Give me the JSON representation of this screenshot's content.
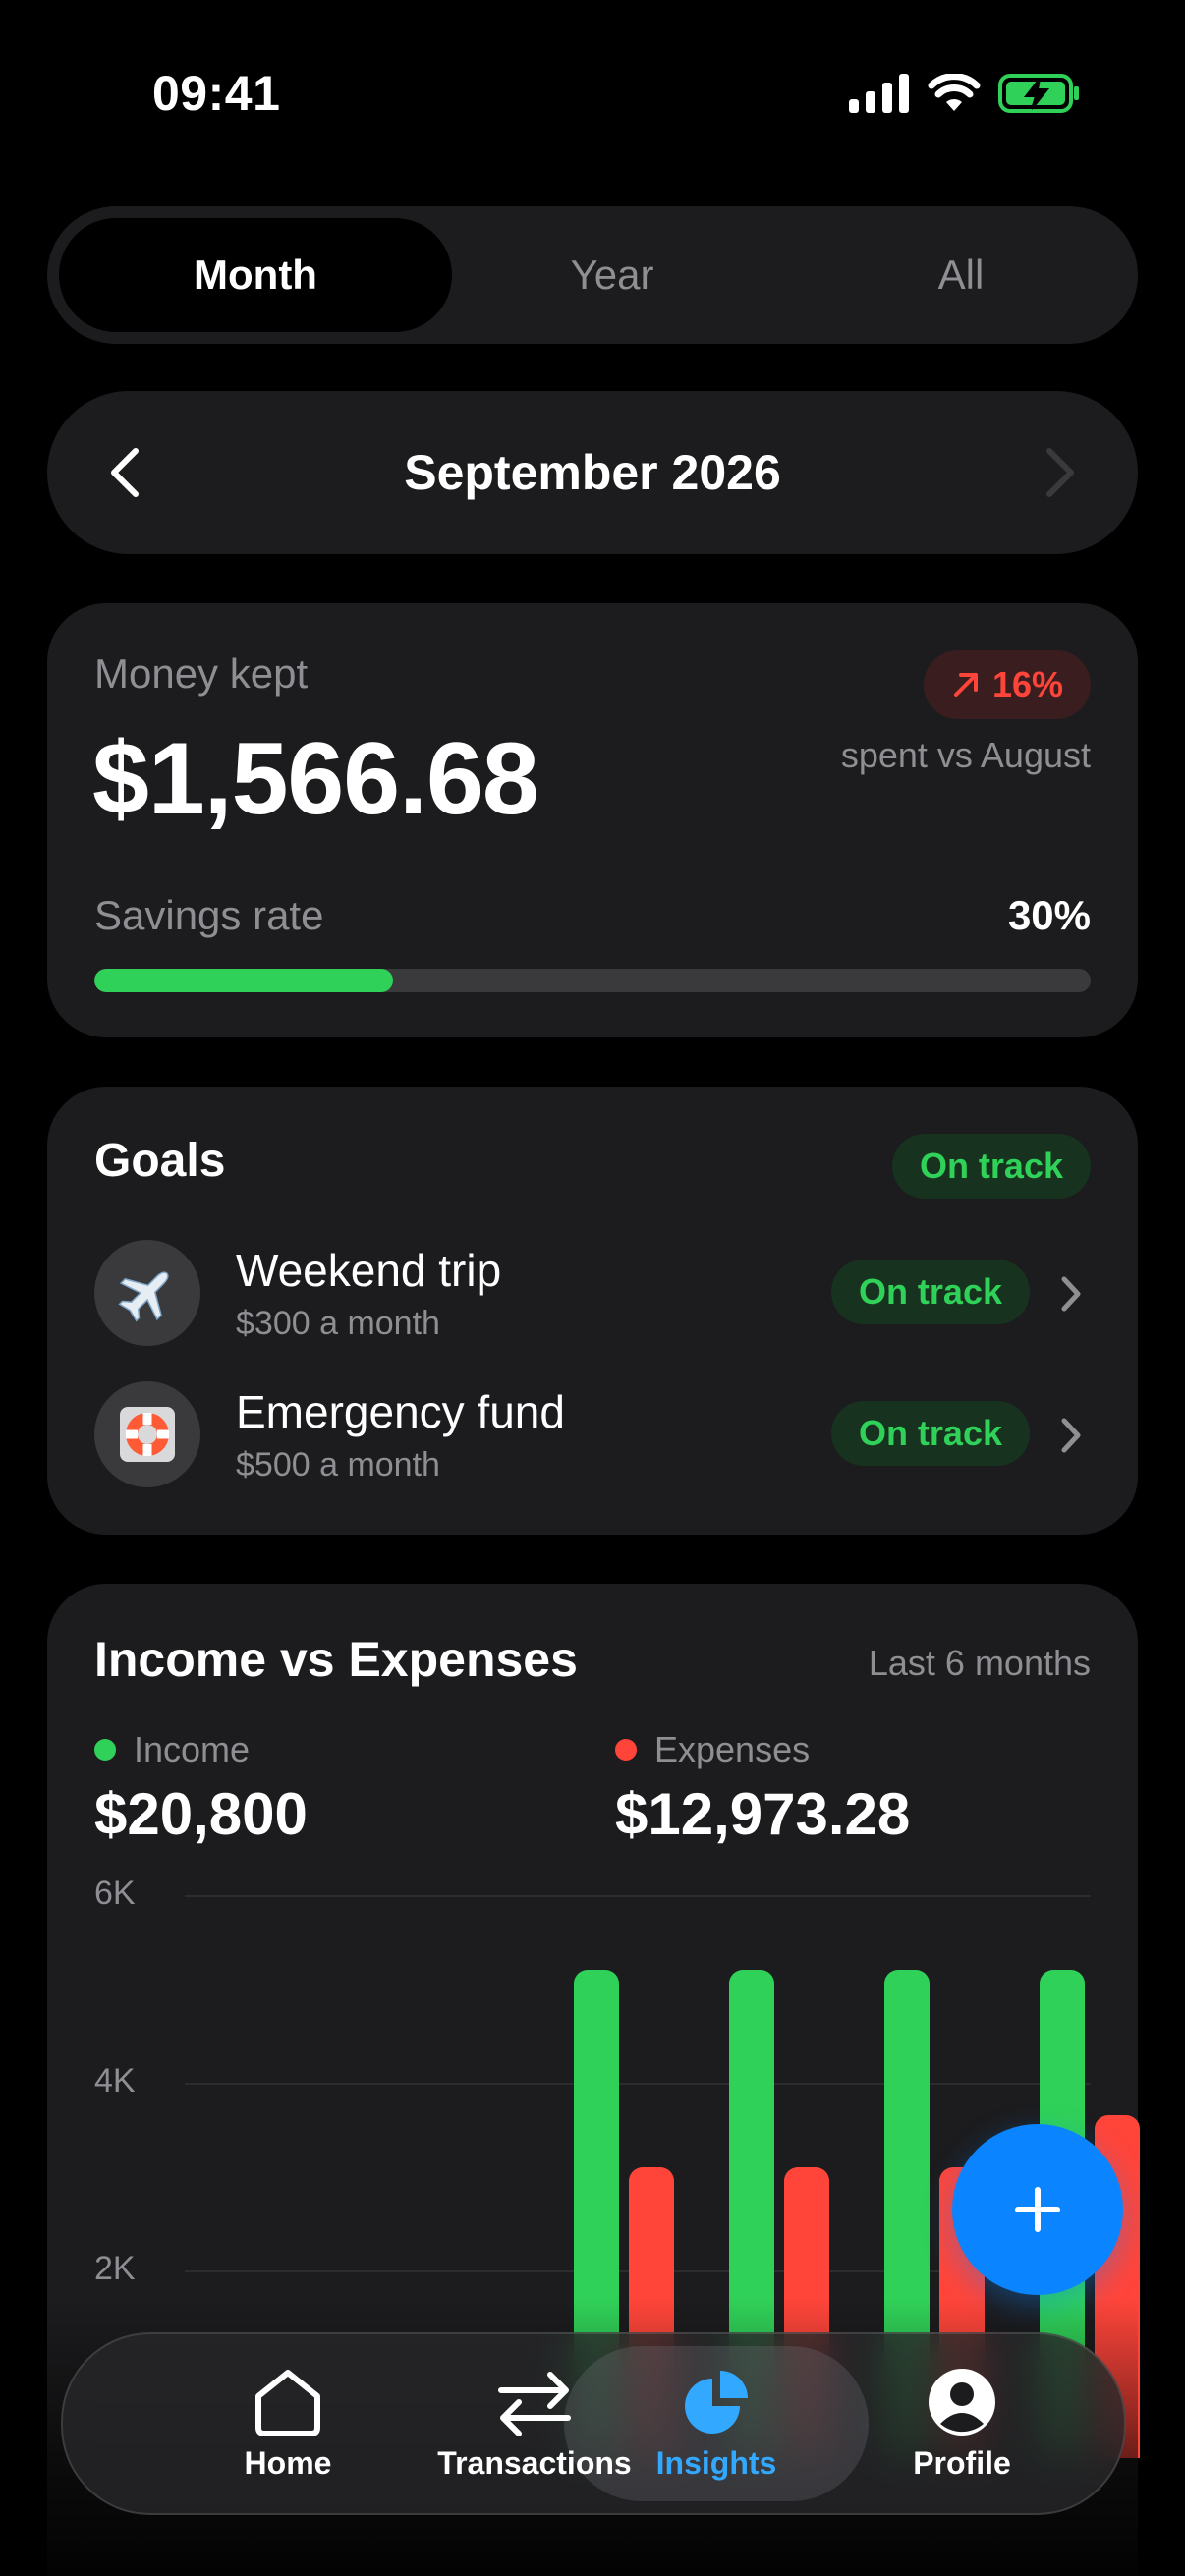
{
  "status_bar": {
    "time": "09:41"
  },
  "segmented": {
    "options": [
      "Month",
      "Year",
      "All"
    ],
    "selected": "Month"
  },
  "month_nav": {
    "title": "September 2026"
  },
  "summary": {
    "label": "Money kept",
    "amount": "$1,566.68",
    "change_badge": "16%",
    "change_caption": "spent vs August",
    "savings_label": "Savings rate",
    "savings_value": "30%",
    "savings_fraction": 0.3
  },
  "goals": {
    "title": "Goals",
    "status": "On track",
    "items": [
      {
        "name": "Weekend trip",
        "sub": "$300 a month",
        "status": "On track",
        "icon": "airplane-icon"
      },
      {
        "name": "Emergency fund",
        "sub": "$500 a month",
        "status": "On track",
        "icon": "life-ring-icon"
      }
    ]
  },
  "income_expenses": {
    "title": "Income vs Expenses",
    "period": "Last 6 months",
    "income_label": "Income",
    "income_value": "$20,800",
    "expenses_label": "Expenses",
    "expenses_value": "$12,973.28",
    "colors": {
      "income": "#30d158",
      "expenses": "#ff453a"
    }
  },
  "chart_data": {
    "type": "bar",
    "yticks": [
      "6K",
      "4K",
      "2K"
    ],
    "ylim": [
      0,
      6000
    ],
    "series": [
      {
        "name": "Income",
        "values": [
          0,
          0,
          5200,
          5200,
          5200,
          5200
        ]
      },
      {
        "name": "Expenses",
        "values": [
          0,
          0,
          3100,
          3100,
          3100,
          3650
        ]
      }
    ]
  },
  "fab": {
    "icon": "plus-icon"
  },
  "tab_bar": {
    "items": [
      {
        "label": "Home",
        "icon": "home-icon"
      },
      {
        "label": "Transactions",
        "icon": "transfer-arrows-icon"
      },
      {
        "label": "Insights",
        "icon": "pie-chart-icon"
      },
      {
        "label": "Profile",
        "icon": "profile-icon"
      }
    ],
    "active": "Insights"
  }
}
